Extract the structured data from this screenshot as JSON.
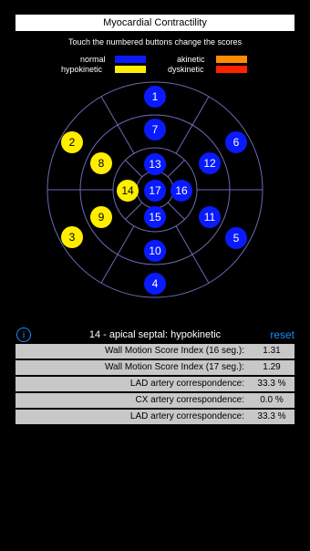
{
  "header": {
    "title": "Myocardial Contractility",
    "instructions": "Touch the numbered buttons change the scores"
  },
  "legend": [
    {
      "label": "normal",
      "color": "#0a1aff"
    },
    {
      "label": "akinetic",
      "color": "#ff8c00"
    },
    {
      "label": "hypokinetic",
      "color": "#ffee00"
    },
    {
      "label": "dyskinetic",
      "color": "#ff2200"
    }
  ],
  "colors": {
    "normal": "#0a1aff",
    "hypokinetic": "#ffee00",
    "ring_stroke": "#6a6ab4",
    "accent": "#1a8cff"
  },
  "segments": [
    {
      "id": "1",
      "state": "normal"
    },
    {
      "id": "2",
      "state": "hypokinetic"
    },
    {
      "id": "3",
      "state": "hypokinetic"
    },
    {
      "id": "4",
      "state": "normal"
    },
    {
      "id": "5",
      "state": "normal"
    },
    {
      "id": "6",
      "state": "normal"
    },
    {
      "id": "7",
      "state": "normal"
    },
    {
      "id": "8",
      "state": "hypokinetic"
    },
    {
      "id": "9",
      "state": "hypokinetic"
    },
    {
      "id": "10",
      "state": "normal"
    },
    {
      "id": "11",
      "state": "normal"
    },
    {
      "id": "12",
      "state": "normal"
    },
    {
      "id": "13",
      "state": "normal"
    },
    {
      "id": "14",
      "state": "hypokinetic"
    },
    {
      "id": "15",
      "state": "normal"
    },
    {
      "id": "16",
      "state": "normal"
    },
    {
      "id": "17",
      "state": "normal"
    }
  ],
  "info_icon": "info-icon",
  "selection": "14 - apical septal: hypokinetic",
  "reset_label": "reset",
  "stats": [
    {
      "label": "Wall Motion Score Index (16 seg.):",
      "value": "1.31"
    },
    {
      "label": "Wall Motion Score Index (17 seg.):",
      "value": "1.29"
    },
    {
      "label": "LAD artery correspondence:",
      "value": "33.3 %"
    },
    {
      "label": "CX artery correspondence:",
      "value": "0.0 %"
    },
    {
      "label": "LAD artery correspondence:",
      "value": "33.3 %"
    }
  ]
}
